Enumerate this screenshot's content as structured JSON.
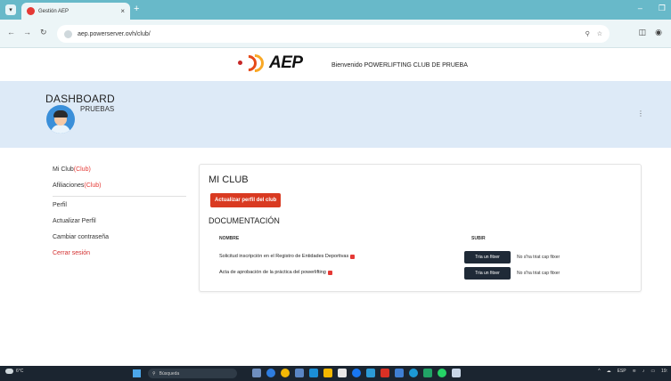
{
  "browser": {
    "tab_title": "Gestión AEP",
    "url": "aep.powerserver.ovh/club/",
    "new_tab": "+",
    "tab_close": "×"
  },
  "header": {
    "logo_text": "AEP",
    "welcome": "Bienvenido POWERLIFTING CLUB DE PRUEBA"
  },
  "dashboard": {
    "title": "DASHBOARD",
    "user_name": "PRUEBAS",
    "menu_icon": "⋮"
  },
  "sidebar": {
    "items": [
      {
        "label": "Mi Club",
        "suffix": "(Club)"
      },
      {
        "label": "Afiliaciones",
        "suffix": "(Club)"
      },
      {
        "label": "Perfil",
        "suffix": ""
      },
      {
        "label": "Actualizar Perfil",
        "suffix": ""
      },
      {
        "label": "Cambiar contraseña",
        "suffix": ""
      },
      {
        "label": "Cerrar sesión",
        "suffix": ""
      }
    ]
  },
  "main": {
    "title": "MI CLUB",
    "update_button": "Actualizar perfil del club",
    "doc_section": "DOCUMENTACIÓN",
    "columns": [
      "NOMBRE",
      "SUBIR"
    ],
    "rows": [
      {
        "name": "Solicitud inscripción en el Registro de Entidades Deportivas",
        "button": "Tria un fitxer",
        "status": "No s'ha triat cap fitxer"
      },
      {
        "name": "Acta de aprobación de la práctica del powerlifting",
        "button": "Tria un fitxer",
        "status": "No s'ha triat cap fitxer"
      }
    ]
  },
  "taskbar": {
    "weather": "6°C",
    "search": "Búsqueda",
    "lang": "ESP",
    "time": "19:"
  },
  "colors": {
    "tabstrip": "#68b9c9",
    "dash_band": "#ddeaf7",
    "accent_red": "#d93a21",
    "file_button": "#1f2a37"
  }
}
